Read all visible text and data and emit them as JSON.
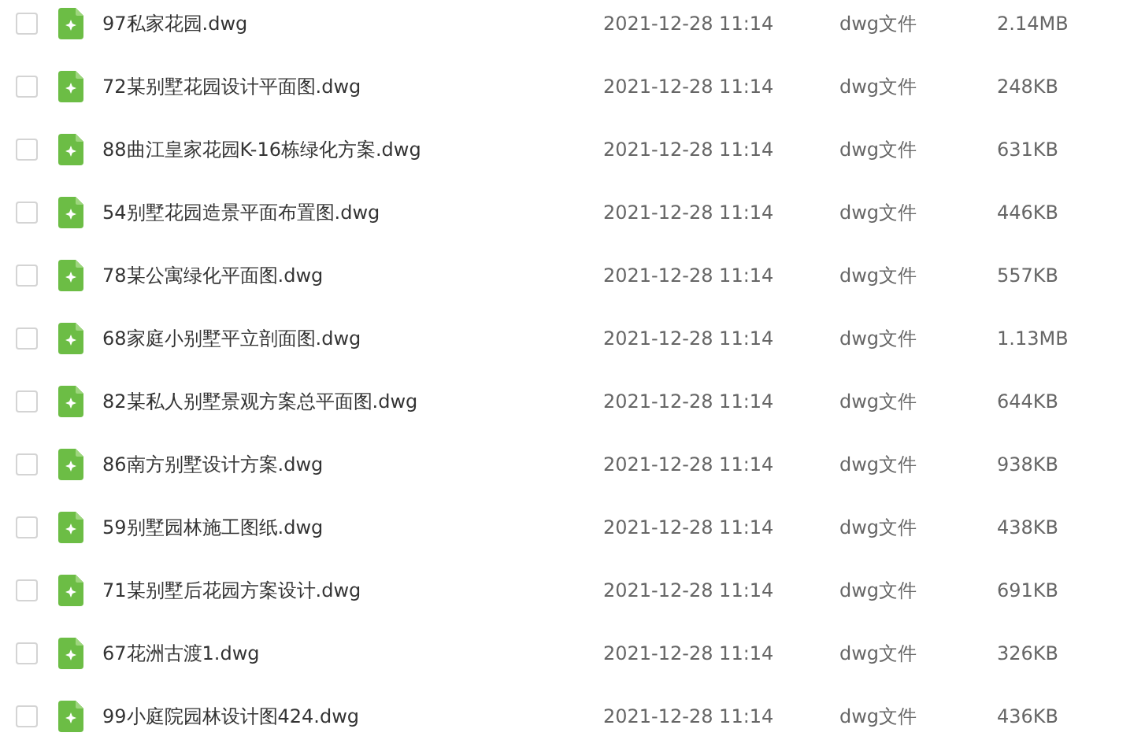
{
  "files": [
    {
      "name": "97私家花园.dwg",
      "modified": "2021-12-28 11:14",
      "type": "dwg文件",
      "size": "2.14MB",
      "checked": false
    },
    {
      "name": "72某别墅花园设计平面图.dwg",
      "modified": "2021-12-28 11:14",
      "type": "dwg文件",
      "size": "248KB",
      "checked": false
    },
    {
      "name": "88曲江皇家花园K-16栋绿化方案.dwg",
      "modified": "2021-12-28 11:14",
      "type": "dwg文件",
      "size": "631KB",
      "checked": false
    },
    {
      "name": "54别墅花园造景平面布置图.dwg",
      "modified": "2021-12-28 11:14",
      "type": "dwg文件",
      "size": "446KB",
      "checked": false
    },
    {
      "name": "78某公寓绿化平面图.dwg",
      "modified": "2021-12-28 11:14",
      "type": "dwg文件",
      "size": "557KB",
      "checked": false
    },
    {
      "name": "68家庭小别墅平立剖面图.dwg",
      "modified": "2021-12-28 11:14",
      "type": "dwg文件",
      "size": "1.13MB",
      "checked": false
    },
    {
      "name": "82某私人别墅景观方案总平面图.dwg",
      "modified": "2021-12-28 11:14",
      "type": "dwg文件",
      "size": "644KB",
      "checked": false
    },
    {
      "name": "86南方别墅设计方案.dwg",
      "modified": "2021-12-28 11:14",
      "type": "dwg文件",
      "size": "938KB",
      "checked": false
    },
    {
      "name": "59别墅园林施工图纸.dwg",
      "modified": "2021-12-28 11:14",
      "type": "dwg文件",
      "size": "438KB",
      "checked": false
    },
    {
      "name": "71某别墅后花园方案设计.dwg",
      "modified": "2021-12-28 11:14",
      "type": "dwg文件",
      "size": "691KB",
      "checked": false
    },
    {
      "name": "67花洲古渡1.dwg",
      "modified": "2021-12-28 11:14",
      "type": "dwg文件",
      "size": "326KB",
      "checked": false
    },
    {
      "name": "99小庭院园林设计图424.dwg",
      "modified": "2021-12-28 11:14",
      "type": "dwg文件",
      "size": "436KB",
      "checked": false
    }
  ]
}
